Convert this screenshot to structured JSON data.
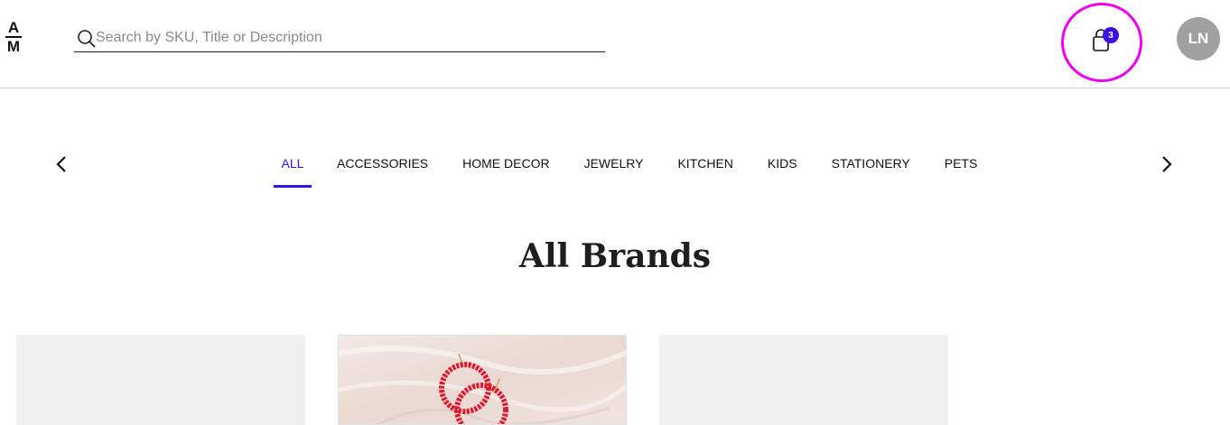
{
  "header": {
    "logo": {
      "top": "A",
      "bottom": "M"
    },
    "search": {
      "placeholder": "Search by SKU, Title or Description",
      "value": ""
    },
    "cart": {
      "count": "3"
    },
    "user": {
      "initials": "LN"
    }
  },
  "nav": {
    "categories": [
      {
        "label": "ALL",
        "active": true
      },
      {
        "label": "ACCESSORIES",
        "active": false
      },
      {
        "label": "HOME DECOR",
        "active": false
      },
      {
        "label": "JEWELRY",
        "active": false
      },
      {
        "label": "KITCHEN",
        "active": false
      },
      {
        "label": "KIDS",
        "active": false
      },
      {
        "label": "STATIONERY",
        "active": false
      },
      {
        "label": "PETS",
        "active": false
      }
    ]
  },
  "main": {
    "title": "All Brands"
  },
  "colors": {
    "accent": "#3a10e5",
    "cart_highlight": "#ee00ee",
    "avatar_bg": "#a0a0a0",
    "card_bg": "#f0f0f0",
    "earring_red": "#e0182e"
  }
}
